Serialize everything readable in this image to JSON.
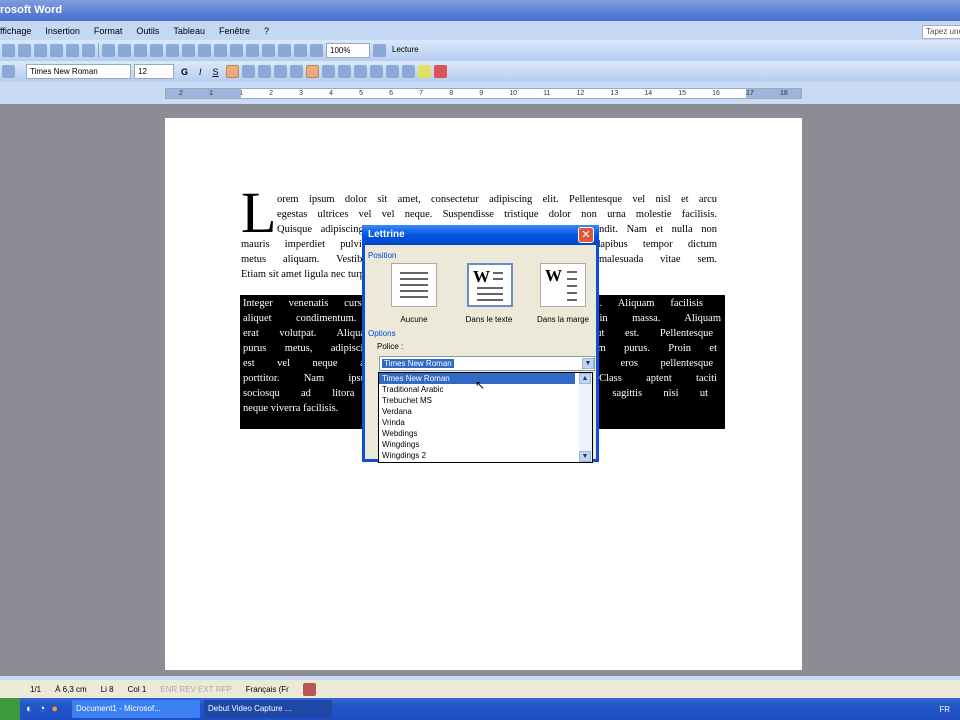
{
  "window": {
    "title": "rosoft Word"
  },
  "menu": [
    "ffichage",
    "Insertion",
    "Format",
    "Outils",
    "Tableau",
    "Fenêtre",
    "?"
  ],
  "ask_placeholder": "Tapez une question",
  "toolbar": {
    "zoom": "100%",
    "reading": "Lecture",
    "font": "Times New Roman",
    "size": "12",
    "bold": "G",
    "italic": "I",
    "underline": "S"
  },
  "ruler": [
    "2",
    "1",
    "1",
    "2",
    "3",
    "4",
    "5",
    "6",
    "7",
    "8",
    "9",
    "10",
    "11",
    "12",
    "13",
    "14",
    "15",
    "16",
    "17",
    "18"
  ],
  "document": {
    "drop_cap": "L",
    "para1": [
      "orem ipsum dolor sit amet, consectetur adipiscing elit. Pellentesque vel nisl et arcu",
      "egestas ultrices vel vel neque. Suspendisse tristique dolor non urna molestie facilisis.",
      "Quisque adipiscing lorem sed ipsum tincidunt ut aliquet erat blandit. Nam et nulla non",
      "mauris imperdiet pulvinar. Nulla facilisi. Donec vitae lectus dapibus tempor dictum",
      "metus aliquam. Vestibulum ante ipsum primis in faucibus malesuada vitae sem.",
      "Etiam sit amet ligula nec turpis volutpat tincidunt a ut egestas."
    ],
    "para2": [
      "Integer venenatis cursus dolor, sed porta nibh commodo vel. Aliquam facilisis",
      "aliquet condimentum. Nulla facilisi. Sed ullamcorper in massa. Aliquam",
      "erat volutpat. Aliquam erat volutpat. Morbi dignissim ut est. Pellentesque",
      "purus metus, adipiscing vel gravida sed, tempor et quam purus. Proin et",
      "est vel neque accumsan ullamcorper. Duis lorem ac eros pellentesque",
      "porttitor. Nam ipsum leo, dignissim vitae lorem. Class aptent taciti",
      "sociosqu ad litora torquent per conubia nostra. Nam sagittis nisi ut",
      "neque viverra facilisis."
    ]
  },
  "dialog": {
    "title": "Lettrine",
    "close": "✕",
    "position_label": "Position",
    "options": [
      "Aucune",
      "Dans le texte",
      "Dans la marge"
    ],
    "options_label": "Options",
    "police_label": "Police :",
    "police_value": "Times New Roman",
    "font_list": [
      "Times New Roman",
      "Traditional Arabic",
      "Trebuchet MS",
      "Verdana",
      "Vrinda",
      "Webdings",
      "Wingdings",
      "Wingdings 2"
    ]
  },
  "status": {
    "page": "1/1",
    "at": "À 6,3 cm",
    "line": "Li 8",
    "col": "Col 1",
    "modes": "ENR  REV  EXT  RFP",
    "lang": "Français (Fr"
  },
  "taskbar": {
    "tasks": [
      "Document1 - Microsof...",
      "Debut Video Capture ..."
    ],
    "lang": "FR"
  }
}
